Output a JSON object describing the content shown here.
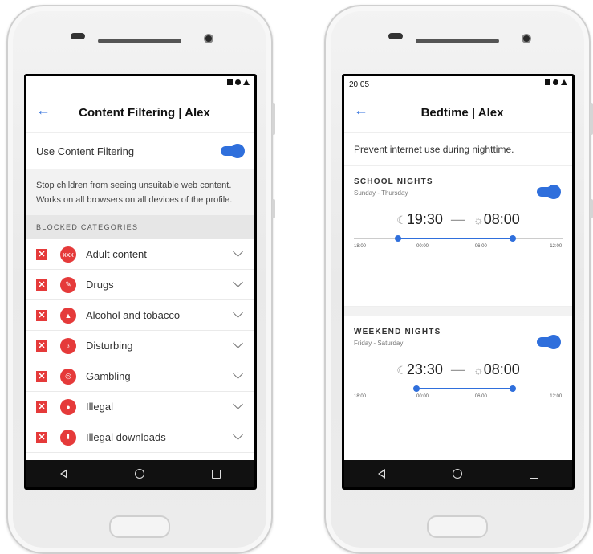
{
  "left": {
    "status_time": "",
    "title": "Content Filtering | Alex",
    "use_filtering_label": "Use Content Filtering",
    "use_filtering_on": true,
    "info_text": "Stop children from seeing unsuitable web content. Works on all browsers on all devices of the profile.",
    "section_header": "BLOCKED CATEGORIES",
    "categories": [
      {
        "label": "Adult content",
        "icon": "xxx-icon",
        "glyph": "xxx"
      },
      {
        "label": "Drugs",
        "icon": "pill-icon",
        "glyph": "✎"
      },
      {
        "label": "Alcohol and tobacco",
        "icon": "bottle-icon",
        "glyph": "▲"
      },
      {
        "label": "Disturbing",
        "icon": "disturbing-icon",
        "glyph": "♪"
      },
      {
        "label": "Gambling",
        "icon": "gambling-icon",
        "glyph": "◎"
      },
      {
        "label": "Illegal",
        "icon": "illegal-icon",
        "glyph": "●"
      },
      {
        "label": "Illegal downloads",
        "icon": "download-icon",
        "glyph": "⬇"
      }
    ],
    "blocked_mark": "✕"
  },
  "right": {
    "status_time": "20:05",
    "title": "Bedtime | Alex",
    "prevent_text": "Prevent internet use during nighttime.",
    "school": {
      "title": "SCHOOL NIGHTS",
      "days": "Sunday - Thursday",
      "enabled": true,
      "start": "19:30",
      "end": "08:00",
      "range_start_fraction": 0.21,
      "range_end_fraction": 0.76,
      "ticks": [
        "18:00",
        "00:00",
        "06:00",
        "12:00"
      ]
    },
    "weekend": {
      "title": "WEEKEND NIGHTS",
      "days": "Friday - Saturday",
      "enabled": true,
      "start": "23:30",
      "end": "08:00",
      "range_start_fraction": 0.3,
      "range_end_fraction": 0.76,
      "ticks": [
        "18:00",
        "00:00",
        "06:00",
        "12:00"
      ]
    }
  },
  "colors": {
    "accent": "#2f6fdc",
    "danger": "#e53a3a"
  }
}
